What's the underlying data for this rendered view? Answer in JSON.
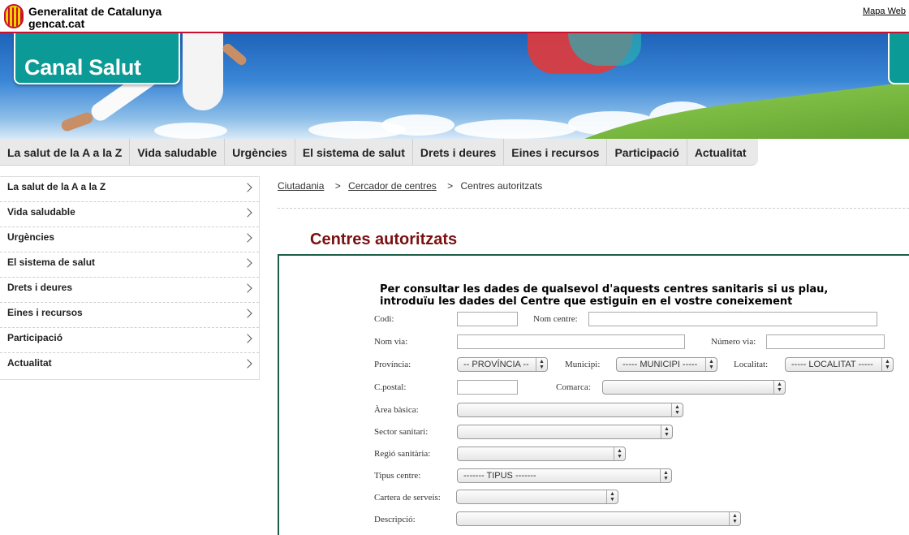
{
  "header": {
    "org_name": "Generalitat de Catalunya",
    "org_url": "gencat.cat",
    "map_link": "Mapa Web",
    "brand_color": "#c8102e"
  },
  "banner": {
    "title": "Canal Salut",
    "accent": "#0b9a95"
  },
  "main_nav": {
    "items": [
      {
        "label": "La salut de la A a la Z"
      },
      {
        "label": "Vida saludable"
      },
      {
        "label": "Urgències"
      },
      {
        "label": "El sistema de salut"
      },
      {
        "label": "Drets i deures"
      },
      {
        "label": "Eines i recursos"
      },
      {
        "label": "Participació"
      },
      {
        "label": "Actualitat"
      }
    ]
  },
  "sidebar": {
    "items": [
      {
        "label": "La salut de la A a la Z"
      },
      {
        "label": "Vida saludable"
      },
      {
        "label": "Urgències"
      },
      {
        "label": "El sistema de salut"
      },
      {
        "label": "Drets i deures"
      },
      {
        "label": "Eines i recursos"
      },
      {
        "label": "Participació"
      },
      {
        "label": "Actualitat"
      }
    ]
  },
  "breadcrumb": {
    "items": [
      "Ciutadania",
      "Cercador de centres",
      "Centres autoritzats"
    ],
    "separator": ">"
  },
  "page": {
    "title": "Centres autoritzats",
    "title_color": "#7a1010"
  },
  "form": {
    "intro_line1": "Per consultar les dades de qualsevol d'aquests centres sanitaris si us plau,",
    "intro_line2": "introduïu les dades del Centre que estiguin en el vostre coneixement",
    "fields": {
      "codi": {
        "label": "Codi:",
        "value": ""
      },
      "nom_centre": {
        "label": "Nom centre:",
        "value": ""
      },
      "nom_via": {
        "label": "Nom via:",
        "value": ""
      },
      "numero_via": {
        "label": "Número via:",
        "value": ""
      },
      "provincia": {
        "label": "Província:",
        "selected": "-- PROVÍNCIA --"
      },
      "municipi": {
        "label": "Municipi:",
        "selected": "----- MUNICIPI -----"
      },
      "localitat": {
        "label": "Localitat:",
        "selected": "----- LOCALITAT -----"
      },
      "cpostal": {
        "label": "C.postal:",
        "value": ""
      },
      "comarca": {
        "label": "Comarca:",
        "selected": ""
      },
      "area_basica": {
        "label": "Àrea bàsica:",
        "selected": ""
      },
      "sector_sanitari": {
        "label": "Sector sanitari:",
        "selected": ""
      },
      "regio_sanitaria": {
        "label": "Regió sanitària:",
        "selected": ""
      },
      "tipus_centre": {
        "label": "Tipus centre:",
        "selected": "------- TIPUS -------"
      },
      "cartera_serveis": {
        "label": "Cartera de serveis:",
        "selected": ""
      },
      "descripcio": {
        "label": "Descripció:",
        "selected": ""
      }
    }
  }
}
